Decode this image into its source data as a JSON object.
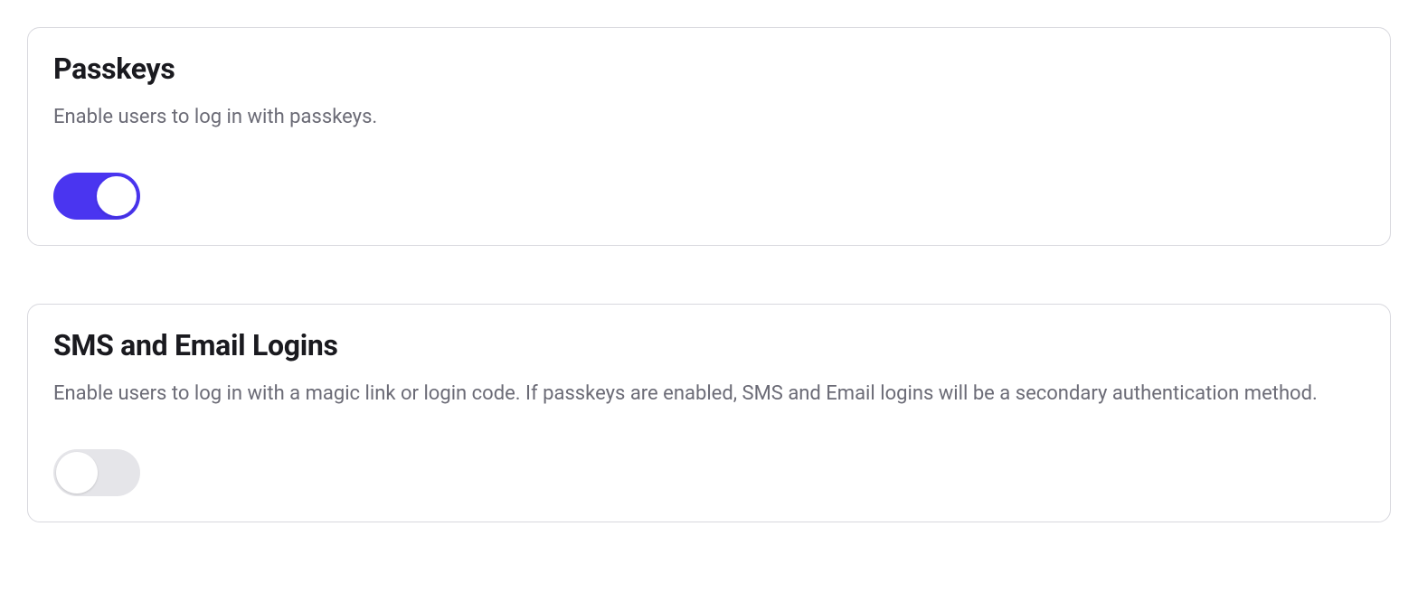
{
  "settings": [
    {
      "title": "Passkeys",
      "description": "Enable users to log in with passkeys.",
      "enabled": true
    },
    {
      "title": "SMS and Email Logins",
      "description": "Enable users to log in with a magic link or login code. If passkeys are enabled, SMS and Email logins will be a secondary authentication method.",
      "enabled": false
    }
  ],
  "colors": {
    "toggle_on": "#4a35f0",
    "toggle_off": "#e5e5e9",
    "border": "#d8d8de",
    "text_primary": "#1a1a1f",
    "text_secondary": "#6b6b76"
  }
}
